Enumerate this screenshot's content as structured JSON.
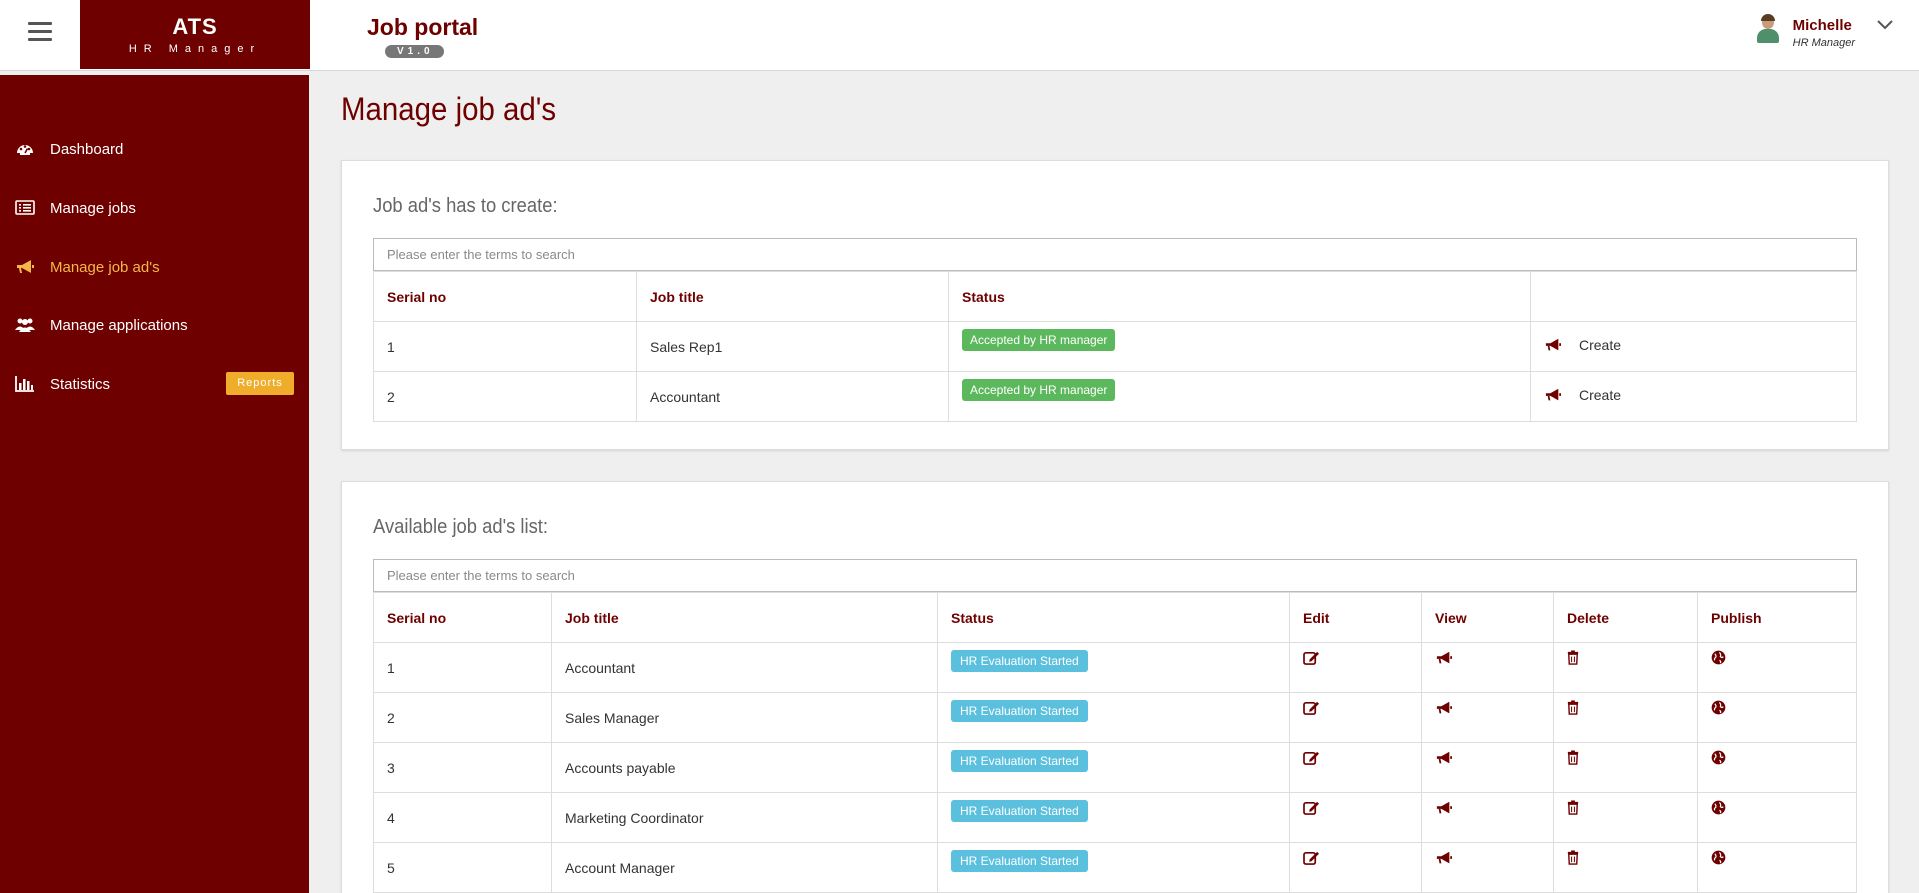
{
  "brand": {
    "title": "ATS",
    "subtitle": "HR Manager"
  },
  "header": {
    "portal_title": "Job portal",
    "version": "V1.0"
  },
  "user": {
    "name": "Michelle",
    "role": "HR Manager"
  },
  "sidebar": {
    "items": [
      {
        "label": "Dashboard",
        "icon": "dashboard-icon"
      },
      {
        "label": "Manage jobs",
        "icon": "list-icon"
      },
      {
        "label": "Manage job ad's",
        "icon": "bullhorn-icon",
        "active": true
      },
      {
        "label": "Manage applications",
        "icon": "users-icon"
      },
      {
        "label": "Statistics",
        "icon": "bar-chart-icon",
        "badge": "Reports"
      }
    ]
  },
  "page": {
    "title": "Manage job ad's"
  },
  "to_create": {
    "title": "Job ad's has to create:",
    "search_placeholder": "Please enter the terms to search",
    "columns": [
      "Serial no",
      "Job title",
      "Status",
      ""
    ],
    "action_label": "Create",
    "rows": [
      {
        "serial": "1",
        "title": "Sales Rep1",
        "status": "Accepted by HR manager"
      },
      {
        "serial": "2",
        "title": "Accountant",
        "status": "Accepted by HR manager"
      }
    ]
  },
  "available": {
    "title": "Available job ad's list:",
    "search_placeholder": "Please enter the terms to search",
    "columns": [
      "Serial no",
      "Job title",
      "Status",
      "Edit",
      "View",
      "Delete",
      "Publish"
    ],
    "rows": [
      {
        "serial": "1",
        "title": "Accountant",
        "status": "HR Evaluation Started"
      },
      {
        "serial": "2",
        "title": "Sales Manager",
        "status": "HR Evaluation Started"
      },
      {
        "serial": "3",
        "title": "Accounts payable",
        "status": "HR Evaluation Started"
      },
      {
        "serial": "4",
        "title": "Marketing Coordinator",
        "status": "HR Evaluation Started"
      },
      {
        "serial": "5",
        "title": "Account Manager",
        "status": "HR Evaluation Started"
      }
    ]
  },
  "colors": {
    "primary": "#6e0000",
    "active": "#f3b847",
    "success": "#5cb85c",
    "info": "#5bc0de",
    "warning": "#f0ad2c"
  }
}
